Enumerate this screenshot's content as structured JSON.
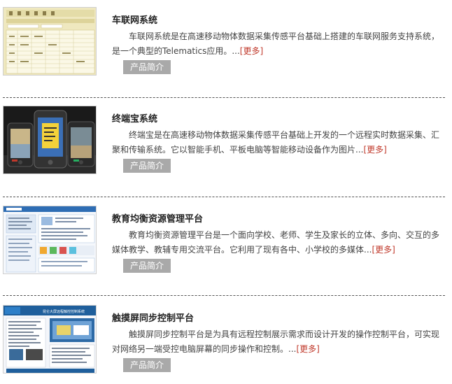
{
  "items": [
    {
      "title": "车联网系统",
      "desc": "车联网系统是在高速移动物体数据采集传感平台基础上搭建的车联网服务支持系统，是一个典型的Telematics应用。...",
      "more": "[更多]",
      "tag": "产品简介",
      "thumb_icon": "telematics-screenshot-thumbnail"
    },
    {
      "title": "终端宝系统",
      "desc": "终端宝是在高速移动物体数据采集传感平台基础上开发的一个远程实时数据采集、汇聚和传输系统。它以智能手机、平板电脑等智能移动设备作为图片...",
      "more": "[更多]",
      "tag": "产品简介",
      "thumb_icon": "smartphones-thumbnail"
    },
    {
      "title": "教育均衡资源管理平台",
      "desc": "教育均衡资源管理平台是一个面向学校、老师、学生及家长的立体、多向、交互的多媒体教学、教辅专用交流平台。它利用了现有各中、小学校的多媒体...",
      "more": "[更多]",
      "tag": "产品简介",
      "thumb_icon": "education-portal-thumbnail"
    },
    {
      "title": "触摸屏同步控制平台",
      "desc": "触摸屏同步控制平台是为具有远程控制展示需求而设计开发的操作控制平台，可实现对网络另一端受控电脑屏幕的同步操作和控制。...",
      "more": "[更多]",
      "tag": "产品简介",
      "thumb_icon": "touchscreen-document-thumbnail",
      "thumb_caption": "昆仑大屏远程触控控制系统"
    }
  ],
  "colors": {
    "more": "#c0392b",
    "tag_bg": "#a9a9a9",
    "divider": "#555555"
  }
}
